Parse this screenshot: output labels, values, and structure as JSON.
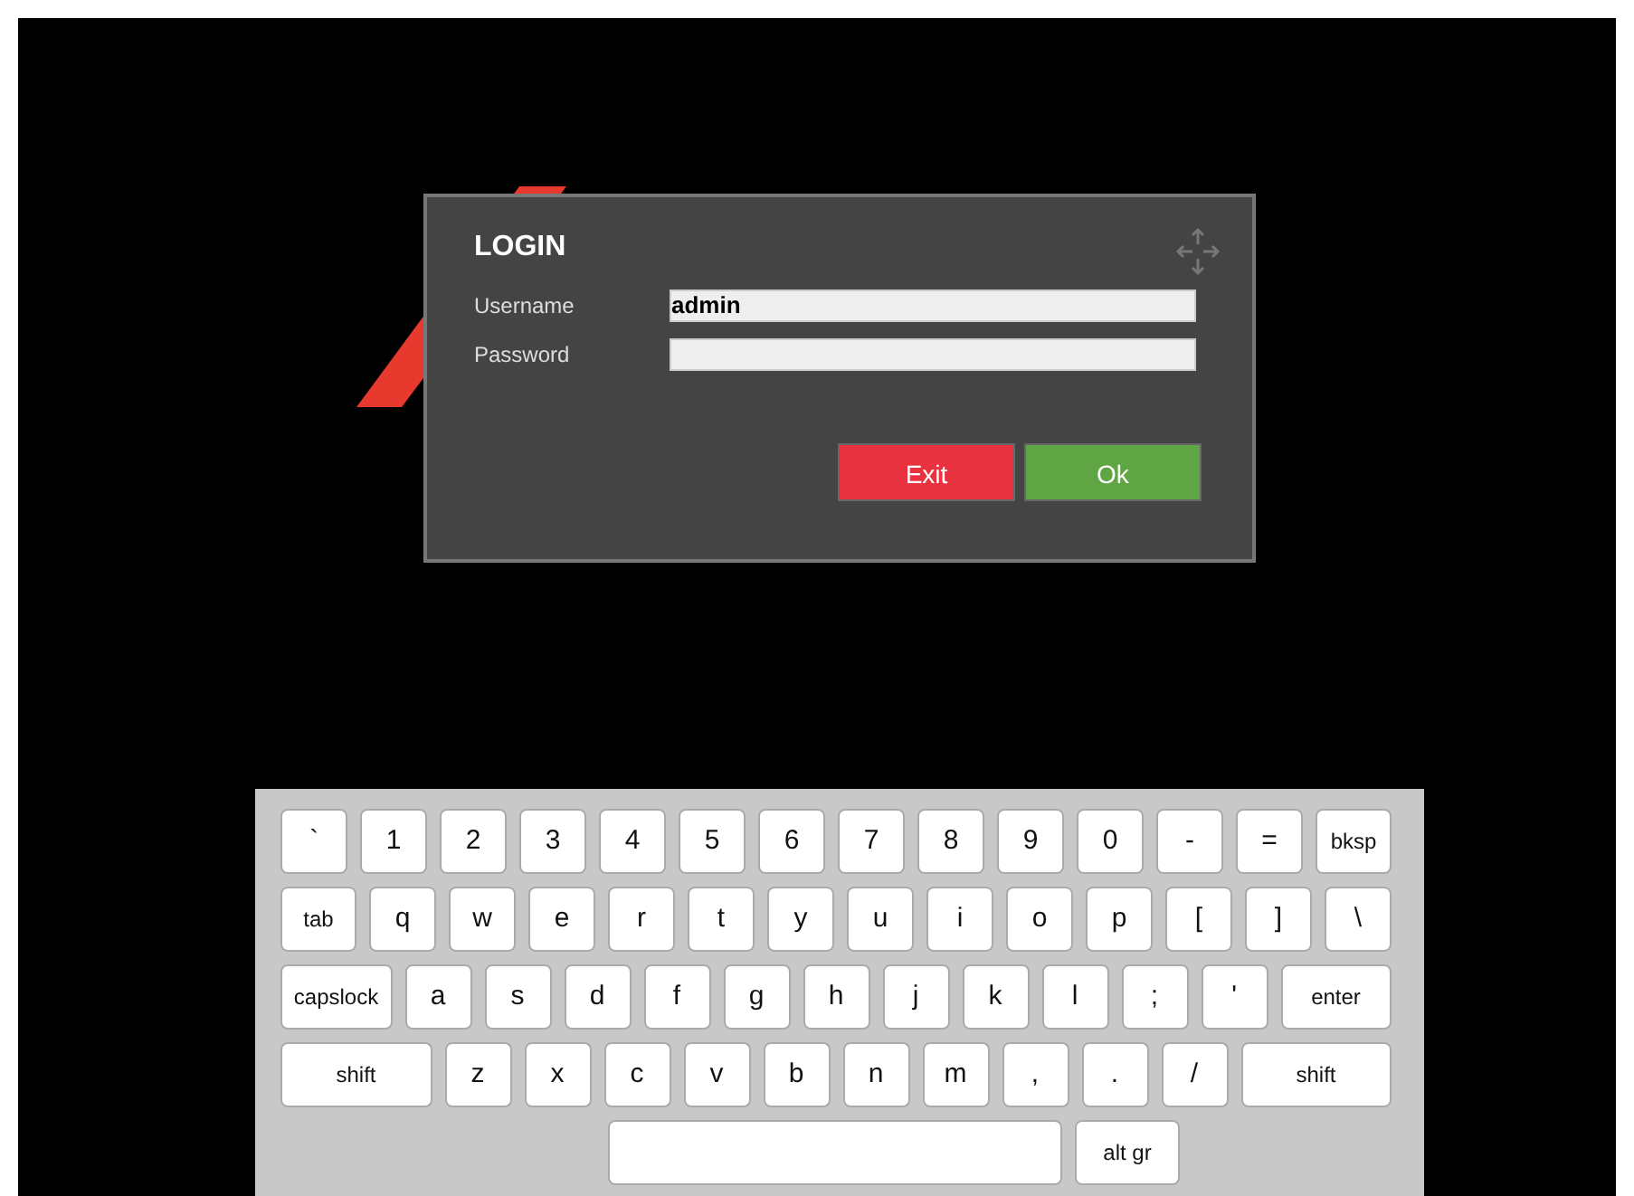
{
  "dialog": {
    "title": "LOGIN",
    "fields": [
      {
        "label": "Username",
        "value": "admin"
      },
      {
        "label": "Password"
      }
    ],
    "buttons": [
      {
        "label": "Exit",
        "kind": "cancel"
      },
      {
        "label": "Ok",
        "kind": "confirm"
      }
    ]
  },
  "keyboard": {
    "rows": [
      {
        "keys": [
          {
            "label": "`",
            "kind": "char"
          },
          {
            "label": "1",
            "kind": "char"
          },
          {
            "label": "2",
            "kind": "char"
          },
          {
            "label": "3",
            "kind": "char"
          },
          {
            "label": "4",
            "kind": "char"
          },
          {
            "label": "5",
            "kind": "char"
          },
          {
            "label": "6",
            "kind": "char"
          },
          {
            "label": "7",
            "kind": "char"
          },
          {
            "label": "8",
            "kind": "char"
          },
          {
            "label": "9",
            "kind": "char"
          },
          {
            "label": "0",
            "kind": "char"
          },
          {
            "label": "-",
            "kind": "char"
          },
          {
            "label": "=",
            "kind": "char"
          },
          {
            "label": "bksp",
            "kind": "control"
          }
        ]
      },
      {
        "keys": [
          {
            "label": "tab",
            "kind": "control"
          },
          {
            "label": "q",
            "kind": "char"
          },
          {
            "label": "w",
            "kind": "char"
          },
          {
            "label": "e",
            "kind": "char"
          },
          {
            "label": "r",
            "kind": "char"
          },
          {
            "label": "t",
            "kind": "char"
          },
          {
            "label": "y",
            "kind": "char"
          },
          {
            "label": "u",
            "kind": "char"
          },
          {
            "label": "i",
            "kind": "char"
          },
          {
            "label": "o",
            "kind": "char"
          },
          {
            "label": "p",
            "kind": "char"
          },
          {
            "label": "[",
            "kind": "char"
          },
          {
            "label": "]",
            "kind": "char"
          },
          {
            "label": "\\",
            "kind": "char"
          }
        ]
      },
      {
        "keys": [
          {
            "label": "capslock",
            "kind": "control"
          },
          {
            "label": "a",
            "kind": "char"
          },
          {
            "label": "s",
            "kind": "char"
          },
          {
            "label": "d",
            "kind": "char"
          },
          {
            "label": "f",
            "kind": "char"
          },
          {
            "label": "g",
            "kind": "char"
          },
          {
            "label": "h",
            "kind": "char"
          },
          {
            "label": "j",
            "kind": "char"
          },
          {
            "label": "k",
            "kind": "char"
          },
          {
            "label": "l",
            "kind": "char"
          },
          {
            "label": ";",
            "kind": "char"
          },
          {
            "label": "'",
            "kind": "char"
          },
          {
            "label": "enter",
            "kind": "control"
          }
        ]
      },
      {
        "keys": [
          {
            "label": "shift",
            "kind": "control"
          },
          {
            "label": "z",
            "kind": "char"
          },
          {
            "label": "x",
            "kind": "char"
          },
          {
            "label": "c",
            "kind": "char"
          },
          {
            "label": "v",
            "kind": "char"
          },
          {
            "label": "b",
            "kind": "char"
          },
          {
            "label": "n",
            "kind": "char"
          },
          {
            "label": "m",
            "kind": "char"
          },
          {
            "label": ",",
            "kind": "char"
          },
          {
            "label": ".",
            "kind": "char"
          },
          {
            "label": "/",
            "kind": "char"
          },
          {
            "label": "shift",
            "kind": "control"
          }
        ]
      },
      {
        "keys": [
          {
            "kind": "space"
          },
          {
            "label": "alt gr",
            "kind": "control"
          }
        ]
      }
    ]
  }
}
